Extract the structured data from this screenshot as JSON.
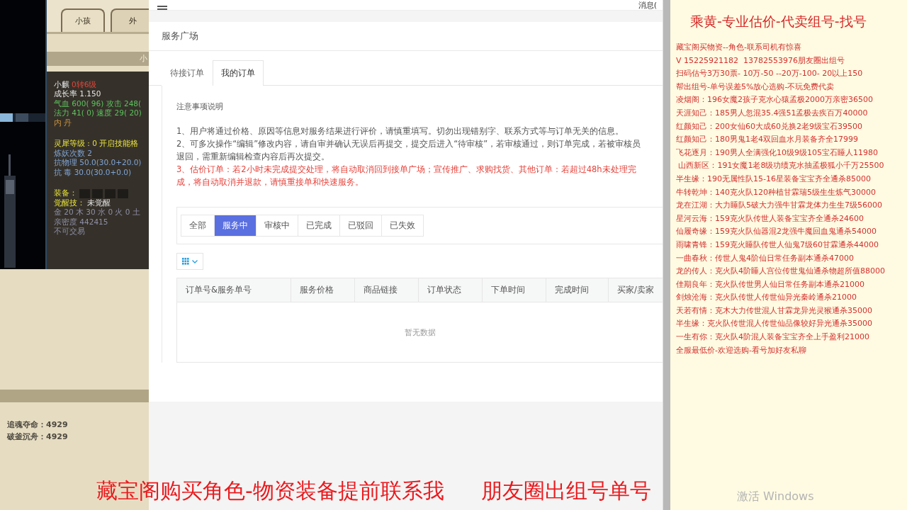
{
  "game_panel": {
    "tabs": [
      {
        "label": "小孩",
        "selected": true
      },
      {
        "label": "外",
        "selected": false
      }
    ],
    "header": "小",
    "stat_groups": [
      [
        {
          "segments": [
            {
              "text": "小麒",
              "kind": "plain"
            },
            {
              "text": "0转6级",
              "kind": "level"
            }
          ]
        },
        {
          "segments": [
            {
              "text": "成长率 1.150",
              "kind": "plain"
            }
          ]
        },
        {
          "segments": [
            {
              "text": "气血 600( 96) 攻击 248(",
              "kind": "attribute"
            }
          ]
        },
        {
          "segments": [
            {
              "text": "法力 41( 0) 速度 29( 20)",
              "kind": "attribute"
            }
          ]
        },
        {
          "segments": [
            {
              "text": "内  丹",
              "kind": "core"
            }
          ]
        }
      ],
      [
        {
          "segments": [
            {
              "text": "灵犀等级 : 0 开启技能格",
              "kind": "label"
            }
          ]
        },
        {
          "segments": [
            {
              "text": "炼妖次数 2",
              "kind": "resist"
            }
          ]
        },
        {
          "segments": [
            {
              "text": "抗物理 50.0(30.0+20.0)",
              "kind": "resist"
            }
          ]
        },
        {
          "segments": [
            {
              "text": "抗  毒 30.0(30.0+0.0)",
              "kind": "resist"
            }
          ]
        }
      ],
      [
        {
          "segments": [
            {
              "text": "装备：",
              "kind": "label"
            }
          ],
          "kind": "equipment"
        },
        {
          "segments": [
            {
              "text": "觉醒技：",
              "kind": "label"
            },
            {
              "text": "未觉醒",
              "kind": "plain"
            }
          ]
        },
        {
          "segments": [
            {
              "text": "金 20 木 30 水 0 火 0 土",
              "kind": "info"
            }
          ]
        },
        {
          "segments": [
            {
              "text": "亲密度 442415",
              "kind": "info"
            }
          ]
        },
        {
          "segments": [
            {
              "text": "不可交易",
              "kind": "info"
            }
          ]
        }
      ]
    ],
    "footer_stats": [
      "追魂夺命：4929",
      "破釜沉舟：4929"
    ]
  },
  "web_page": {
    "top_bar": {
      "message_link": "消息("
    },
    "title": "服务广场",
    "tabs": [
      {
        "label": "待接订单",
        "selected": false
      },
      {
        "label": "我的订单",
        "selected": true
      }
    ],
    "notice_title": "注意事项说明",
    "notes": [
      {
        "kind": "normal",
        "text": "1、用户将通过价格、原因等信息对服务结果进行评价，请慎重填写。切勿出现错别字、联系方式等与订单无关的信息。"
      },
      {
        "kind": "normal",
        "text": "2、可多次操作“编辑”修改内容，请自审并确认无误后再提交，提交后进入“待审核”，若审核通过，则订单完成，若被审核员退回，需重新编辑检查内容后再次提交。"
      },
      {
        "kind": "warning",
        "text": "3、估价订单：若2小时未完成提交处理，将自动取消回到接单广场；宣传推广、求购找货、其他订单：若超过48h未处理完成，将自动取消并退款，请慎重接单和快速服务。"
      }
    ],
    "filters": [
      {
        "label": "全部",
        "selected": false
      },
      {
        "label": "服务中",
        "selected": true
      },
      {
        "label": "审核中",
        "selected": false
      },
      {
        "label": "已完成",
        "selected": false
      },
      {
        "label": "已驳回",
        "selected": false
      },
      {
        "label": "已失效",
        "selected": false
      }
    ],
    "table": {
      "columns": [
        "订单号&服务单号",
        "服务价格",
        "商品链接",
        "订单状态",
        "下单时间",
        "完成时间",
        "买家/卖家"
      ],
      "empty_text": "暂无数据"
    }
  },
  "ad_panel": {
    "title": "乘黄-专业估价-代卖组号-找号",
    "lines": [
      "藏宝阁买物资--角色-联系司机有惊喜",
      "V 15225921182  13782553976朋友圈出组号",
      "扫码估号3万30票- 10万-50 --20万-100- 20以上150",
      "帮出组号-单号误差5%放心选购-不玩免费代卖",
      "凌烟阁：196女魔2孩子克水心猿孟极2000万亲密36500",
      "天涯知己：185男人忽混35.4强51孟极去疾百万40000",
      "红颜知己：200女仙60大成60兑换2老9级宝石39500",
      "红颜知己：180男鬼1老4双回血水月装备齐全17999",
      "飞花逐月：190男人全满强化10级9级105宝石睡人11980",
      " 山西新区：191女魔1老8级功绩克水抽孟极狐小千万25500",
      "半生缘：190无属性队15-16星装备宝宝齐全通杀85000",
      "牛转乾坤：140克火队120种植甘霖瑞5级生生炼气30000",
      "龙在江湖：大力睡队5破大力强牛甘霖龙体力生生7级56000",
      "星河云海：159克火队传世人装备宝宝齐全通杀24600",
      "仙履奇缘：159克火队仙器混2龙强牛魔回血鬼通杀54000",
      "雨啸青锋：159克火睡队传世人仙鬼7级60甘霖通杀44000",
      "一曲春秋：传世人鬼4阶仙日常任务副本通杀47000",
      "龙的传人：克火队4阶睡人宫位传世鬼仙通杀物超所值88000",
      "佳期良年：克火队传世男人仙日常任务副本通杀21000",
      "剑烛沧海：克火队传世人传世仙异光秦岭通杀21000",
      "天若有情：克木大力传世混人甘霖龙异光灵猴通杀35000",
      "半生缘：克火队传世混人传世仙品像较好异光通杀35000",
      "一生有你：克火队4阶混人装备宝宝齐全上手盈利21000",
      "全服最低价-欢迎选购-看号加好友私聊"
    ]
  },
  "caption": [
    "藏宝阁购买角色-物资装备提前联系我",
    "朋友圈出组号单号"
  ],
  "os_notice": "激活 Windows"
}
